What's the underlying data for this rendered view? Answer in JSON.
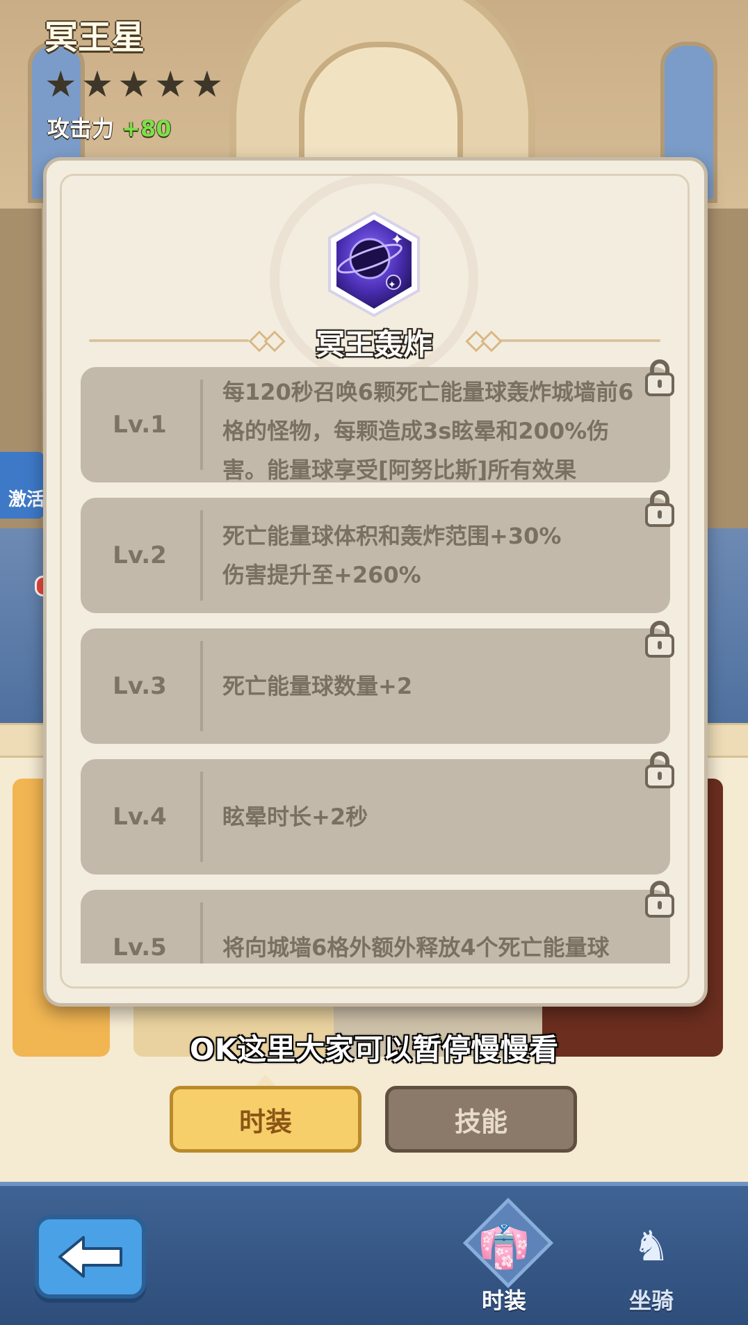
{
  "hero": {
    "name": "冥王星",
    "stars": [
      "★",
      "★",
      "★",
      "★",
      "★"
    ],
    "attack_label": "攻击力",
    "attack_bonus": "+80"
  },
  "side_tab": {
    "label": "激活"
  },
  "subtitle": "OK这里大家可以暂停慢慢看",
  "tabs": {
    "costume": "时装",
    "skill": "技能"
  },
  "bottom_nav": {
    "back_icon": "arrow-left-icon",
    "items": [
      {
        "label": "时装",
        "icon": "costume-icon",
        "active": true
      },
      {
        "label": "坐骑",
        "icon": "mount-icon",
        "active": false
      }
    ]
  },
  "skill": {
    "name": "冥王轰炸",
    "icon": "dark-planet-icon",
    "levels": [
      {
        "level": "Lv.1",
        "desc": "每120秒召唤6颗死亡能量球轰炸城墙前6格的怪物，每颗造成3s眩晕和200%伤害。能量球享受[阿努比斯]所有效果",
        "locked": true
      },
      {
        "level": "Lv.2",
        "desc": "死亡能量球体积和轰炸范围+30%\n伤害提升至+260%",
        "locked": true
      },
      {
        "level": "Lv.3",
        "desc": "死亡能量球数量+2",
        "locked": true
      },
      {
        "level": "Lv.4",
        "desc": "眩晕时长+2秒",
        "locked": true
      },
      {
        "level": "Lv.5",
        "desc": "将向城墙6格外额外释放4个死亡能量球",
        "locked": true
      }
    ]
  },
  "colors": {
    "modal_bg": "#f3ede0",
    "locked_row": "#c2b9aa",
    "active_tab": "#f7cf6a",
    "inactive_tab": "#8b7a69",
    "nav_bg": "#3f6394",
    "attack_plus": "#7be04a"
  }
}
